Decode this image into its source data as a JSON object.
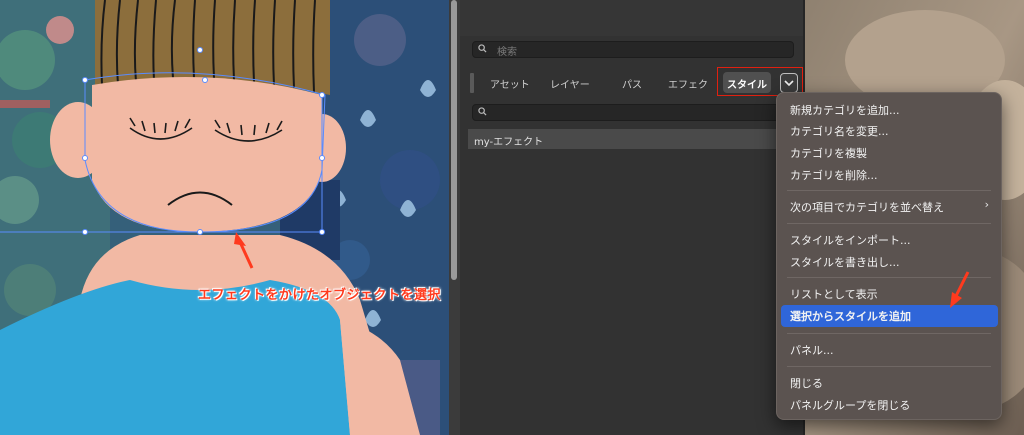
{
  "canvas": {
    "annotation_label": "エフェクトをかけたオブジェクトを選択"
  },
  "panel": {
    "top_search_placeholder": "検索",
    "tabs": [
      {
        "label": "アセット"
      },
      {
        "label": "レイヤー"
      },
      {
        "label": "パス"
      },
      {
        "label": "エフェク"
      },
      {
        "label": "スタイル",
        "active": true
      }
    ],
    "list_items": [
      "my-エフェクト"
    ]
  },
  "context_menu": {
    "items": [
      "新規カテゴリを追加...",
      "カテゴリ名を変更...",
      "カテゴリを複製",
      "カテゴリを削除...",
      "次の項目でカテゴリを並べ替え",
      "スタイルをインポート...",
      "スタイルを書き出し...",
      "リストとして表示",
      "選択からスタイルを追加",
      "パネル...",
      "閉じる",
      "パネルグループを閉じる"
    ],
    "highlighted": "選択からスタイルを追加"
  },
  "colors": {
    "accent_highlight": "#2f66d9",
    "annotation_red": "#ff3a1e",
    "panel_bg": "#323232"
  }
}
